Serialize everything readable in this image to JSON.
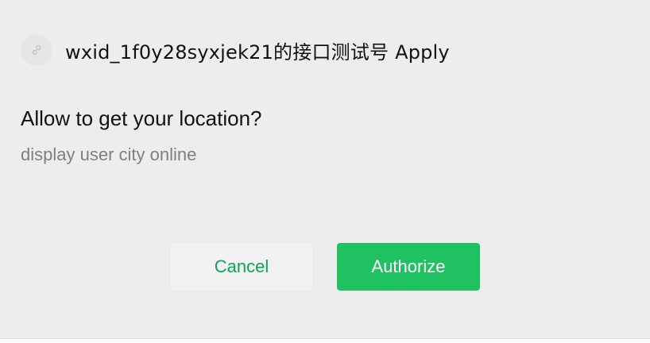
{
  "app": {
    "title": "wxid_1f0y28syxjek21的接口测试号 Apply",
    "icon": "link-icon"
  },
  "prompt": {
    "question": "Allow to get your location?",
    "description": "display user city online"
  },
  "actions": {
    "cancel_label": "Cancel",
    "authorize_label": "Authorize"
  },
  "colors": {
    "background": "#ededed",
    "accent": "#1fc161",
    "cancel_text": "#07a755",
    "secondary_text": "#7f7f7f"
  }
}
